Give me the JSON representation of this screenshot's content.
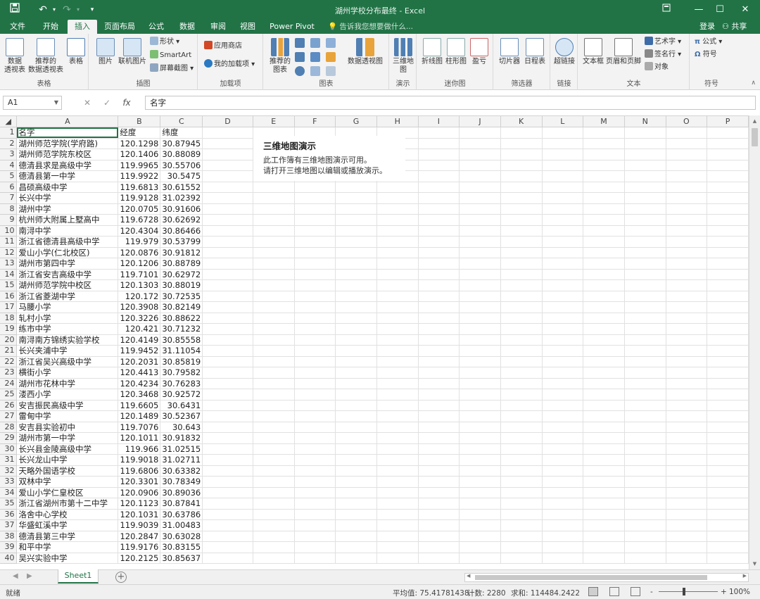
{
  "window": {
    "title": "湖州学校分布最终 - Excel",
    "quick_access": [
      "save-icon",
      "undo-icon",
      "redo-icon",
      "customize-icon"
    ],
    "controls": [
      "ribbon-display-icon",
      "minimize-icon",
      "maximize-icon",
      "close-icon"
    ]
  },
  "ribbon_tabs": {
    "items": [
      "文件",
      "开始",
      "插入",
      "页面布局",
      "公式",
      "数据",
      "审阅",
      "视图",
      "Power Pivot"
    ],
    "active": "插入",
    "tell_me": "告诉我您想要做什么...",
    "signin": "登录",
    "share": "共享"
  },
  "ribbon": {
    "groups": {
      "tables": "表格",
      "illustrations": "插图",
      "addins": "加载项",
      "charts": "图表",
      "tours": "演示",
      "sparklines": "迷你图",
      "filters": "筛选器",
      "links": "链接",
      "text": "文本",
      "symbols": "符号"
    },
    "buttons": {
      "pivot_table": "数据\n透视表",
      "rec_pivot": "推荐的\n数据透视表",
      "table": "表格",
      "pictures": "图片",
      "online_pictures": "联机图片",
      "shapes": "形状",
      "smartart": "SmartArt",
      "screenshot": "屏幕截图",
      "store": "应用商店",
      "my_addins": "我的加载项",
      "rec_charts": "推荐的\n图表",
      "pivot_chart": "数据透视图",
      "map3d": "三维地\n图",
      "line_spark": "折线图",
      "column_spark": "柱形图",
      "winloss_spark": "盈亏",
      "slicer": "切片器",
      "timeline": "日程表",
      "hyperlink": "超链接",
      "textbox": "文本框",
      "header_footer": "页眉和页脚",
      "wordart": "艺术字",
      "signature": "签名行",
      "object": "对象",
      "equation": "公式",
      "symbol": "符号"
    }
  },
  "formula_bar": {
    "name_box": "A1",
    "cancel": "✕",
    "enter": "✓",
    "fx": "fx",
    "content": "名字"
  },
  "columns": [
    "A",
    "B",
    "C",
    "D",
    "E",
    "F",
    "G",
    "H",
    "I",
    "J",
    "K",
    "L",
    "M",
    "N",
    "O",
    "P"
  ],
  "headers": [
    "名字",
    "经度",
    "纬度"
  ],
  "rows": [
    [
      "湖州师范学院(学府路)",
      "120.1298",
      "30.87945"
    ],
    [
      "湖州师范学院东校区",
      "120.1406",
      "30.88089"
    ],
    [
      "德清县求是高级中学",
      "119.9965",
      "30.55706"
    ],
    [
      "德清县第一中学",
      "119.9922",
      "30.5475"
    ],
    [
      "昌硕高级中学",
      "119.6813",
      "30.61552"
    ],
    [
      "长兴中学",
      "119.9128",
      "31.02392"
    ],
    [
      "湖州中学",
      "120.0705",
      "30.91606"
    ],
    [
      "杭州师大附属上墅高中",
      "119.6728",
      "30.62692"
    ],
    [
      "南浔中学",
      "120.4304",
      "30.86466"
    ],
    [
      "浙江省德清县高级中学",
      "119.979",
      "30.53799"
    ],
    [
      "爱山小学(仁北校区)",
      "120.0876",
      "30.91812"
    ],
    [
      "湖州市第四中学",
      "120.1206",
      "30.88789"
    ],
    [
      "浙江省安吉高级中学",
      "119.7101",
      "30.62972"
    ],
    [
      "湖州师范学院中校区",
      "120.1303",
      "30.88019"
    ],
    [
      "浙江省菱湖中学",
      "120.172",
      "30.72535"
    ],
    [
      "马腰小学",
      "120.3908",
      "30.82149"
    ],
    [
      "轧村小学",
      "120.3226",
      "30.88622"
    ],
    [
      "练市中学",
      "120.421",
      "30.71232"
    ],
    [
      "南浔南方锦绣实验学校",
      "120.4149",
      "30.85558"
    ],
    [
      "长兴夹浦中学",
      "119.9452",
      "31.11054"
    ],
    [
      "浙江省吴兴高级中学",
      "120.2031",
      "30.85819"
    ],
    [
      "横街小学",
      "120.4413",
      "30.79582"
    ],
    [
      "湖州市花林中学",
      "120.4234",
      "30.76283"
    ],
    [
      "溇西小学",
      "120.3468",
      "30.92572"
    ],
    [
      "安吉振民高级中学",
      "119.6605",
      "30.6431"
    ],
    [
      "雷甸中学",
      "120.1489",
      "30.52367"
    ],
    [
      "安吉县实验初中",
      "119.7076",
      "30.643"
    ],
    [
      "湖州市第一中学",
      "120.1011",
      "30.91832"
    ],
    [
      "长兴县金陵高级中学",
      "119.966",
      "31.02515"
    ],
    [
      "长兴龙山中学",
      "119.9018",
      "31.02711"
    ],
    [
      "天略外国语学校",
      "119.6806",
      "30.63382"
    ],
    [
      "双林中学",
      "120.3301",
      "30.78349"
    ],
    [
      "爱山小学仁皇校区",
      "120.0906",
      "30.89036"
    ],
    [
      "浙江省湖州市第十二中学",
      "120.1123",
      "30.87841"
    ],
    [
      "洛舍中心学校",
      "120.1031",
      "30.63786"
    ],
    [
      "华盛虹溪中学",
      "119.9039",
      "31.00483"
    ],
    [
      "德清县第三中学",
      "120.2847",
      "30.63028"
    ],
    [
      "和平中学",
      "119.9176",
      "30.83155"
    ],
    [
      "吴兴实验中学",
      "120.2125",
      "30.85637"
    ]
  ],
  "map_note": {
    "title": "三维地图演示",
    "line1": "此工作簿有三维地图演示可用。",
    "line2": "请打开三维地图以编辑或播放演示。"
  },
  "sheets": {
    "active": "Sheet1",
    "add": "+"
  },
  "status": {
    "ready": "就绪",
    "average": "平均值: 75.41781438",
    "count": "计数: 2280",
    "sum": "求和: 114484.2422",
    "zoom": "100%",
    "zoom_minus": "-",
    "zoom_plus": "+"
  },
  "colors": {
    "brand": "#217346",
    "ribbon_bg": "#f3f3f3",
    "grid_line": "#e1e1e1"
  }
}
